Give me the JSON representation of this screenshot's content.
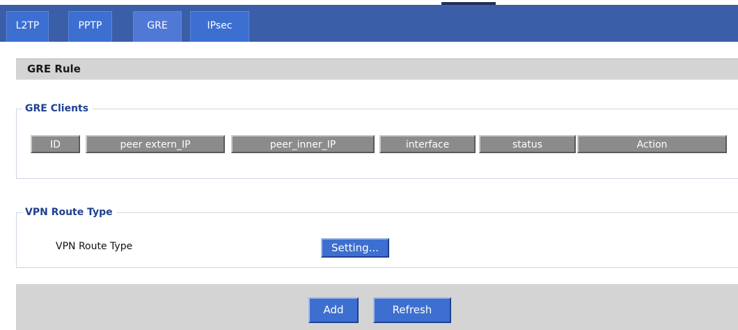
{
  "tabs": [
    {
      "label": "L2TP",
      "active": false
    },
    {
      "label": "PPTP",
      "active": false
    },
    {
      "label": "GRE",
      "active": true
    },
    {
      "label": "IPsec",
      "active": false
    }
  ],
  "section_header": {
    "title": "GRE Rule"
  },
  "gre_clients": {
    "legend": "GRE Clients",
    "columns": [
      "ID",
      "peer extern_IP",
      "peer_inner_IP",
      "interface",
      "status",
      "Action"
    ],
    "rows": []
  },
  "vpn_route": {
    "legend": "VPN Route Type",
    "label": "VPN Route Type",
    "button_label": "Setting..."
  },
  "footer": {
    "add_label": "Add",
    "refresh_label": "Refresh"
  },
  "colors": {
    "tab_bar": "#3a5fa8",
    "tab": "#3d6fd0",
    "legend_text": "#1f3f8f",
    "header_bg": "#d4d4d4",
    "table_header": "#8b8b8b"
  }
}
